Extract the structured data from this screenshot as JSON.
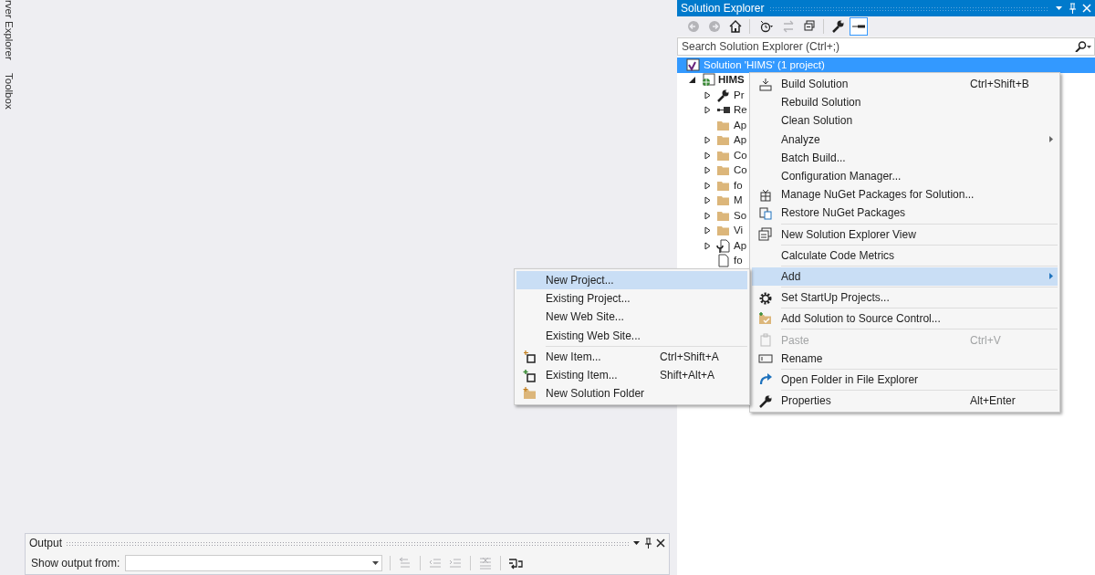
{
  "side_tabs": [
    {
      "label": "rver Explorer"
    },
    {
      "label": "Toolbox"
    }
  ],
  "output": {
    "title": "Output",
    "source_label": "Show output from:",
    "toolbar": [
      {
        "kind": "prev",
        "disabled": true
      },
      {
        "kind": "outdent",
        "disabled": true
      },
      {
        "kind": "indent",
        "disabled": true
      },
      {
        "kind": "clear",
        "disabled": true
      },
      {
        "kind": "wrap",
        "disabled": false
      }
    ]
  },
  "solution_explorer": {
    "title": "Solution Explorer",
    "toolbar": [
      {
        "kind": "back",
        "disabled": true,
        "selected": false
      },
      {
        "kind": "forward",
        "disabled": true,
        "selected": false
      },
      {
        "kind": "home",
        "disabled": false,
        "selected": false
      },
      {
        "kind": "history",
        "disabled": false,
        "selected": false
      },
      {
        "kind": "sync",
        "disabled": true,
        "selected": false
      },
      {
        "kind": "collapse",
        "disabled": false,
        "selected": false
      },
      {
        "kind": "properties",
        "disabled": false,
        "selected": false
      },
      {
        "kind": "preview",
        "disabled": false,
        "selected": true
      }
    ],
    "search": {
      "placeholder": "Search Solution Explorer (Ctrl+;)"
    },
    "tree": [
      {
        "label": "Solution 'HIMS' (1 project)",
        "kind": "solution",
        "selected": true,
        "children": [
          {
            "label": "HIMS",
            "kind": "project",
            "selected": false,
            "expanded": true,
            "children": [
              {
                "label": "Pr",
                "kind": "wrench",
                "selected": false,
                "expanded": false
              },
              {
                "label": "Re",
                "kind": "references",
                "selected": false,
                "expanded": false
              },
              {
                "label": "Ap",
                "kind": "folder",
                "selected": false
              },
              {
                "label": "Ap",
                "kind": "folder",
                "selected": false,
                "expanded": false
              },
              {
                "label": "Co",
                "kind": "folder",
                "selected": false,
                "expanded": false
              },
              {
                "label": "Co",
                "kind": "folder",
                "selected": false,
                "expanded": false
              },
              {
                "label": "fo",
                "kind": "folder",
                "selected": false,
                "expanded": false
              },
              {
                "label": "M",
                "kind": "folder",
                "selected": false,
                "expanded": false
              },
              {
                "label": "So",
                "kind": "folder",
                "selected": false,
                "expanded": false
              },
              {
                "label": "Vi",
                "kind": "folder",
                "selected": false,
                "expanded": false
              },
              {
                "label": "Ap",
                "kind": "config",
                "selected": false,
                "expanded": false
              },
              {
                "label": "fo",
                "kind": "file",
                "selected": false
              }
            ]
          }
        ]
      }
    ]
  },
  "context_menu": {
    "items": [
      {
        "kind": "build",
        "label": "Build Solution",
        "shortcut": "Ctrl+Shift+B",
        "selected": false,
        "disabled": false,
        "submenu": false
      },
      {
        "kind": "plain",
        "label": "Rebuild Solution",
        "selected": false,
        "disabled": false,
        "submenu": false
      },
      {
        "kind": "plain",
        "label": "Clean Solution",
        "selected": false,
        "disabled": false,
        "submenu": false
      },
      {
        "kind": "plain",
        "label": "Analyze",
        "selected": false,
        "disabled": false,
        "submenu": true
      },
      {
        "kind": "plain",
        "label": "Batch Build...",
        "selected": false,
        "disabled": false,
        "submenu": false
      },
      {
        "kind": "plain",
        "label": "Configuration Manager...",
        "selected": false,
        "disabled": false,
        "submenu": false
      },
      {
        "kind": "nuget",
        "label": "Manage NuGet Packages for Solution...",
        "selected": false,
        "disabled": false,
        "submenu": false
      },
      {
        "kind": "restore",
        "label": "Restore NuGet Packages",
        "selected": false,
        "disabled": false,
        "submenu": false
      },
      {
        "kind": "separator"
      },
      {
        "kind": "view",
        "label": "New Solution Explorer View",
        "selected": false,
        "disabled": false,
        "submenu": false
      },
      {
        "kind": "separator"
      },
      {
        "kind": "plain",
        "label": "Calculate Code Metrics",
        "selected": false,
        "disabled": false,
        "submenu": false
      },
      {
        "kind": "separator"
      },
      {
        "kind": "plain",
        "label": "Add",
        "selected": true,
        "disabled": false,
        "submenu": true
      },
      {
        "kind": "separator"
      },
      {
        "kind": "gear",
        "label": "Set StartUp Projects...",
        "selected": false,
        "disabled": false,
        "submenu": false
      },
      {
        "kind": "separator"
      },
      {
        "kind": "sourcecontrol",
        "label": "Add Solution to Source Control...",
        "selected": false,
        "disabled": false,
        "submenu": false
      },
      {
        "kind": "separator"
      },
      {
        "kind": "paste",
        "label": "Paste",
        "shortcut": "Ctrl+V",
        "selected": false,
        "disabled": true,
        "submenu": false
      },
      {
        "kind": "rename",
        "label": "Rename",
        "selected": false,
        "disabled": false,
        "submenu": false
      },
      {
        "kind": "separator"
      },
      {
        "kind": "openfolder",
        "label": "Open Folder in File Explorer",
        "selected": false,
        "disabled": false,
        "submenu": false
      },
      {
        "kind": "separator"
      },
      {
        "kind": "properties",
        "label": "Properties",
        "shortcut": "Alt+Enter",
        "selected": false,
        "disabled": false,
        "submenu": false
      }
    ]
  },
  "add_submenu": {
    "items": [
      {
        "kind": "plain",
        "label": "New Project...",
        "selected": true,
        "disabled": false
      },
      {
        "kind": "plain",
        "label": "Existing Project...",
        "selected": false,
        "disabled": false
      },
      {
        "kind": "plain",
        "label": "New Web Site...",
        "selected": false,
        "disabled": false
      },
      {
        "kind": "plain",
        "label": "Existing Web Site...",
        "selected": false,
        "disabled": false
      },
      {
        "kind": "separator"
      },
      {
        "kind": "newitem",
        "label": "New Item...",
        "shortcut": "Ctrl+Shift+A",
        "selected": false,
        "disabled": false
      },
      {
        "kind": "existingitem",
        "label": "Existing Item...",
        "shortcut": "Shift+Alt+A",
        "selected": false,
        "disabled": false
      },
      {
        "kind": "newfolder",
        "label": "New Solution Folder",
        "selected": false,
        "disabled": false
      }
    ]
  }
}
